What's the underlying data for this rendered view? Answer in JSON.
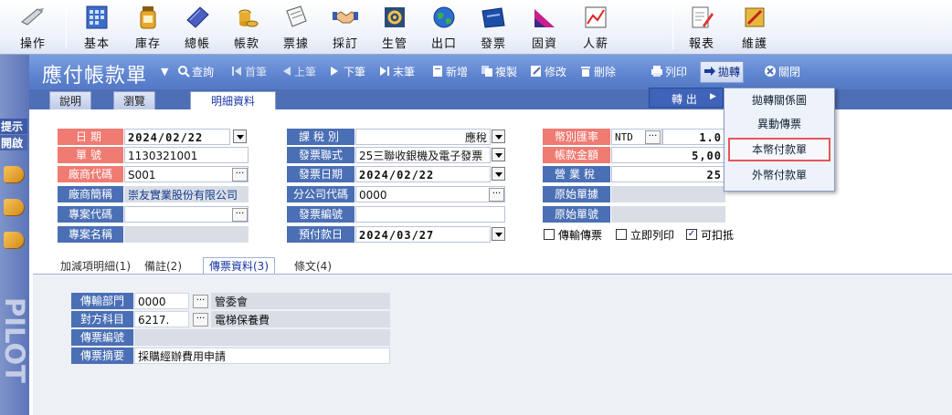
{
  "toolbar": {
    "items": [
      {
        "label": "操作",
        "icon": "pen-tool-icon"
      },
      {
        "label": "基本",
        "icon": "calendar-grid-icon"
      },
      {
        "label": "庫存",
        "icon": "jar-icon"
      },
      {
        "label": "總帳",
        "icon": "ledger-book-icon"
      },
      {
        "label": "帳款",
        "icon": "coins-icon"
      },
      {
        "label": "票據",
        "icon": "ticket-icon"
      },
      {
        "label": "採訂",
        "icon": "handshake-icon"
      },
      {
        "label": "生管",
        "icon": "production-icon"
      },
      {
        "label": "出口",
        "icon": "globe-icon"
      },
      {
        "label": "發票",
        "icon": "invoice-folder-icon"
      },
      {
        "label": "固資",
        "icon": "asset-chart-icon"
      },
      {
        "label": "人薪",
        "icon": "payroll-chart-icon"
      },
      {
        "label": "報表",
        "icon": "report-icon"
      },
      {
        "label": "維護",
        "icon": "maintenance-icon"
      }
    ]
  },
  "left_strip": {
    "tab1": "提示",
    "tab2": "開啟",
    "brand_text": "PILOT"
  },
  "title_bar": {
    "title": "應付帳款單",
    "dropdown_glyph": "▼",
    "actions": [
      {
        "label": "查詢",
        "icon": "search-icon"
      },
      {
        "label": "首筆",
        "icon": "first-record-icon"
      },
      {
        "label": "上筆",
        "icon": "prev-record-icon"
      },
      {
        "label": "下筆",
        "icon": "next-record-icon"
      },
      {
        "label": "末筆",
        "icon": "last-record-icon"
      },
      {
        "label": "新增",
        "icon": "new-icon"
      },
      {
        "label": "複製",
        "icon": "copy-icon"
      },
      {
        "label": "修改",
        "icon": "edit-icon"
      },
      {
        "label": "刪除",
        "icon": "delete-icon"
      },
      {
        "label": "列印",
        "icon": "print-icon"
      },
      {
        "label": "拋轉",
        "icon": "transfer-icon"
      },
      {
        "label": "關閉",
        "icon": "close-icon"
      }
    ]
  },
  "tabs": [
    "說明",
    "瀏覽",
    "明細資料"
  ],
  "form": {
    "col1": {
      "date_label": "日期",
      "date_value": "2024/02/22",
      "number_label": "單號",
      "number_value": "1130321001",
      "vendor_code_label": "廠商代碼",
      "vendor_code_value": "S001",
      "vendor_name_label": "廠商簡稱",
      "vendor_name_value": "崇友實業股份有限公司",
      "project_code_label": "專案代碼",
      "project_code_value": "",
      "project_name_label": "專案名稱",
      "project_name_value": ""
    },
    "col2": {
      "tax_type_label": "課稅別",
      "tax_type_value": "應稅",
      "invoice_type_label": "發票聯式",
      "invoice_type_value": "25三聯收銀機及電子發票",
      "invoice_date_label": "發票日期",
      "invoice_date_value": "2024/02/22",
      "branch_code_label": "分公司代碼",
      "branch_code_value": "0000",
      "invoice_no_label": "發票編號",
      "invoice_no_value": "",
      "due_date_label": "預付款日",
      "due_date_value": "2024/03/27"
    },
    "col3": {
      "currency_label": "幣別匯率",
      "currency_value": "NTD",
      "rate_value": "1.0",
      "amount_label": "帳款金額",
      "amount_value": "5,00",
      "tax_label": "營業稅",
      "tax_value": "25",
      "orig_doc_label": "原始單據",
      "orig_doc_value": "",
      "orig_no_label": "原始單號",
      "orig_no_value": ""
    },
    "checkboxes": [
      {
        "label": "傳輸傳票",
        "checked": false
      },
      {
        "label": "立即列印",
        "checked": false
      },
      {
        "label": "可扣抵",
        "checked": true
      }
    ]
  },
  "sub_tabs": [
    "加減項明細(1)",
    "備註(2)",
    "傳票資料(3)",
    "條文(4)"
  ],
  "voucher": {
    "dept_label": "傳輸部門",
    "dept_code": "0000",
    "dept_name": "管委會",
    "account_label": "對方科目",
    "account_code": "6217.",
    "account_name": "電梯保養費",
    "voucher_no_label": "傳票編號",
    "voucher_no_value": "",
    "summary_label": "傳票摘要",
    "summary_value": "採購經辦費用申請"
  },
  "menu": {
    "level1": "轉 出",
    "level1_arrow": "▶",
    "level2": [
      "拋轉關係圖",
      "異動傳票",
      "本幣付款單",
      "外幣付款單"
    ]
  }
}
